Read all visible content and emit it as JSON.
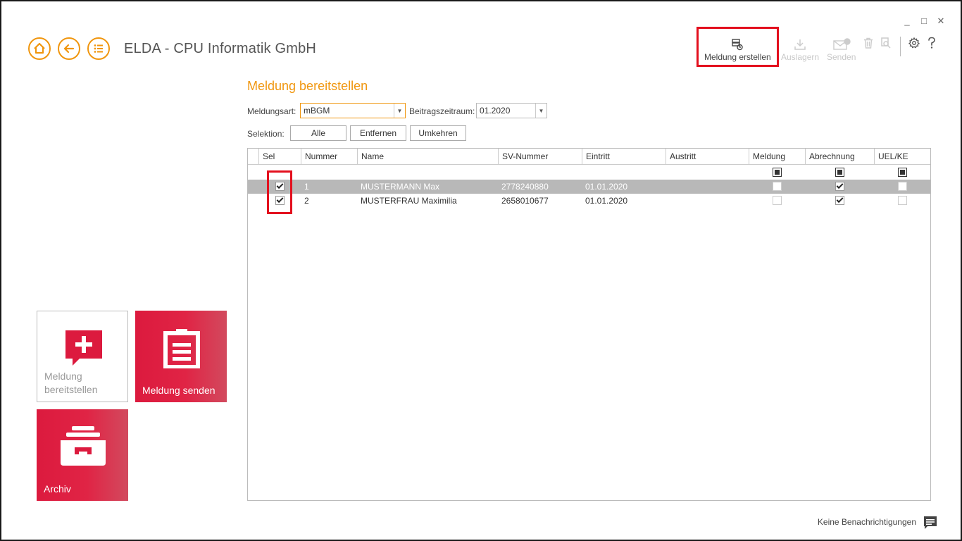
{
  "window": {
    "controls": [
      "_",
      "□",
      "✕"
    ]
  },
  "header": {
    "title": "ELDA - CPU Informatik GmbH",
    "nav": [
      {
        "name": "home-icon"
      },
      {
        "name": "back-arrow-icon"
      },
      {
        "name": "menu-list-icon"
      }
    ],
    "accent_color": "#f0960e"
  },
  "toolbar": {
    "create_label": "Meldung erstellen",
    "export_label": "Auslagern",
    "send_label": "Senden",
    "delete_icon": "trash-icon",
    "search_icon": "search-icon",
    "settings_icon": "gear-icon",
    "help_icon": "help-icon",
    "highlight_color": "#e3101e"
  },
  "page": {
    "title": "Meldung bereitstellen",
    "meldungsart_label": "Meldungsart:",
    "meldungsart_value": "mBGM",
    "beitragszeitraum_label": "Beitragszeitraum:",
    "beitragszeitraum_value": "01.2020",
    "selektion_label": "Selektion:",
    "btn_alle": "Alle",
    "btn_entfernen": "Entfernen",
    "btn_umkehren": "Umkehren"
  },
  "grid": {
    "columns": [
      "Sel",
      "Nummer",
      "Name",
      "SV-Nummer",
      "Eintritt",
      "Austritt",
      "Meldung",
      "Abrechnung",
      "UEL/KE"
    ],
    "filter_row": {
      "meldung": "partial",
      "abrechnung": "partial",
      "uel_ke": "partial"
    },
    "rows": [
      {
        "sel": true,
        "nummer": "1",
        "name": "MUSTERMANN Max",
        "sv_nummer": "2778240880",
        "eintritt": "01.01.2020",
        "austritt": "",
        "meldung": false,
        "abrechnung": true,
        "uel_ke": false,
        "selected": true
      },
      {
        "sel": true,
        "nummer": "2",
        "name": "MUSTERFRAU Maximilia",
        "sv_nummer": "2658010677",
        "eintritt": "01.01.2020",
        "austritt": "",
        "meldung": false,
        "abrechnung": true,
        "uel_ke": false,
        "selected": false
      }
    ]
  },
  "tiles": {
    "bereitstellen_label": "Meldung bereitstellen",
    "senden_label": "Meldung senden",
    "archiv_label": "Archiv"
  },
  "footer": {
    "notifications_text": "Keine Benachrichtigungen"
  }
}
